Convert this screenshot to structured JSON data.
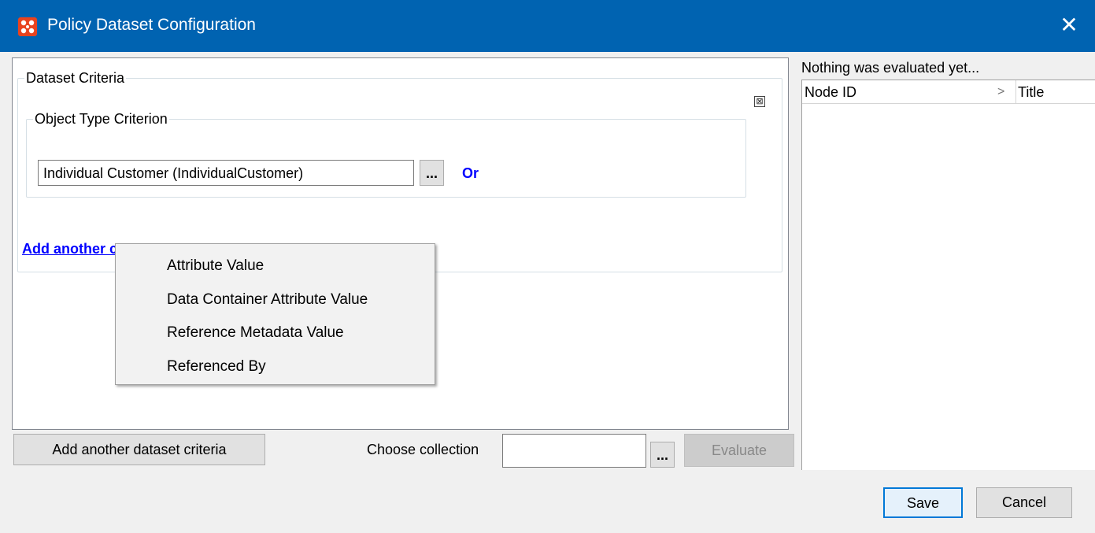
{
  "window": {
    "title": "Policy Dataset Configuration",
    "close_symbol": "✕",
    "icon": "app-logo-icon",
    "titlebar_color": "#0063b1",
    "icon_color": "#e8431f"
  },
  "dataset_criteria": {
    "legend": "Dataset Criteria",
    "remove_symbol": "⊠",
    "object_type": {
      "legend": "Object Type Criterion",
      "value": "Individual Customer (IndividualCustomer)",
      "browse_label": "...",
      "or_label": "Or"
    },
    "add_another_label": "Add another criterion"
  },
  "context_menu": {
    "items": [
      {
        "label": "Attribute Value"
      },
      {
        "label": "Data Container Attribute Value"
      },
      {
        "label": "Reference Metadata Value"
      },
      {
        "label": "Referenced By"
      }
    ]
  },
  "evaluation": {
    "status": "Nothing was evaluated yet...",
    "columns": [
      "Node ID",
      "Title"
    ],
    "sort_icon": "chevron-right-icon"
  },
  "footer": {
    "add_dataset_label": "Add another dataset criteria",
    "choose_collection_label": "Choose collection",
    "collection_value": "",
    "collection_browse_label": "...",
    "evaluate_label": "Evaluate",
    "save_label": "Save",
    "cancel_label": "Cancel"
  },
  "colors": {
    "link": "#0000ff",
    "focus_border": "#0078d7"
  }
}
